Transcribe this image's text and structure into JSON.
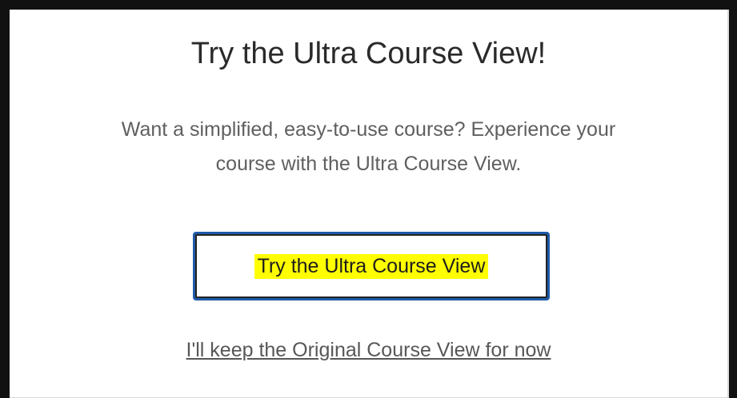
{
  "dialog": {
    "title": "Try the Ultra Course View!",
    "description_line_1": "Want a simplified, easy-to-use course? Experience your",
    "description_line_2": "course with the Ultra Course View.",
    "primary_button_label": "Try the Ultra Course View",
    "secondary_link_label": "I'll keep the Original Course View for now"
  },
  "colors": {
    "highlight": "#ffff00",
    "button_border": "#1f5aa8",
    "frame": "#111111"
  }
}
